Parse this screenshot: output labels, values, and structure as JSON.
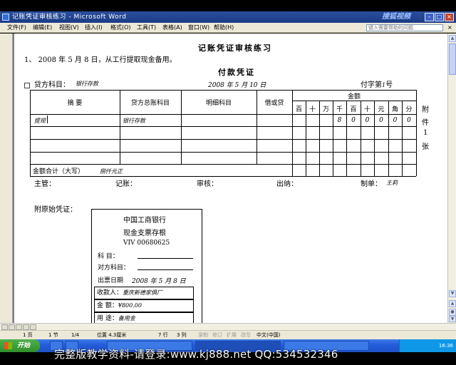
{
  "window": {
    "title": "记账凭证审核练习 - Microsoft Word",
    "overlay_logo": "搜狐视频"
  },
  "menu": {
    "items": [
      "文件(F)",
      "编辑(E)",
      "视图(V)",
      "插入(I)",
      "格式(O)",
      "工具(T)",
      "表格(A)",
      "窗口(W)",
      "帮助(H)"
    ],
    "help_placeholder": "键入需要帮助的问题",
    "close_doc": "×"
  },
  "document": {
    "heading": "记账凭证审核练习",
    "task": "1、 2008 年 5 月 8 日，从工行提取现金备用。",
    "voucher": {
      "title": "付款凭证",
      "credit_account_label": "贷方科目：",
      "credit_account_value": "银行存款",
      "date": "2008 年 5 月 10 日",
      "number_label": "付字第",
      "number_value": "1",
      "number_suffix": "号",
      "headers": {
        "summary": "摘 要",
        "debit_account": "贷方总账科目",
        "detail_account": "明细科目",
        "dc": "借或贷",
        "amount": "金额",
        "units": [
          "百",
          "十",
          "万",
          "千",
          "百",
          "十",
          "元",
          "角",
          "分"
        ]
      },
      "row1": {
        "summary": "提现",
        "account": "银行存款",
        "digits": [
          "",
          "",
          "",
          "8",
          "0",
          "0",
          "0",
          "0",
          "0"
        ]
      },
      "total_label": "金额合计（大写）",
      "total_value": "捌仟元正",
      "attach": [
        "附",
        "件",
        "1",
        "张"
      ],
      "signatures": {
        "supervisor": "主管：",
        "bookkeeping": "记账：",
        "audit": "审核：",
        "cashier": "出纳：",
        "maker": "制单：",
        "maker_name": "王莉"
      }
    },
    "original_voucher_label": "附原始凭证：",
    "stub": {
      "bank": "中国工商银行",
      "title": "现金支票存根",
      "serial": "VIV 00680625",
      "subject_label": "科    目：",
      "counter_label": "对方科目：",
      "issue_date_label": "出票日期",
      "issue_date_value": "2008 年 5 月 8 日",
      "payee_label": "收款人：",
      "payee_value": "重庆新德家俱厂",
      "amount_label": "金    额：",
      "amount_value": "¥800.00",
      "purpose_label": "用    途：",
      "purpose_value": "备用金"
    }
  },
  "statusbar": {
    "page": "1 页",
    "section": "1 节",
    "page_of": "1/4",
    "position": "位置 4.3厘米",
    "line": "7 行",
    "col": "3 列",
    "rec": "录制",
    "trk": "修订",
    "ext": "扩展",
    "ovr": "改写",
    "lang": "中文(中国)"
  },
  "taskbar": {
    "start": "开始",
    "clock": "16:36"
  },
  "watermark": "完整版教学资料-请登录:www.kj888.net QQ:534532346"
}
